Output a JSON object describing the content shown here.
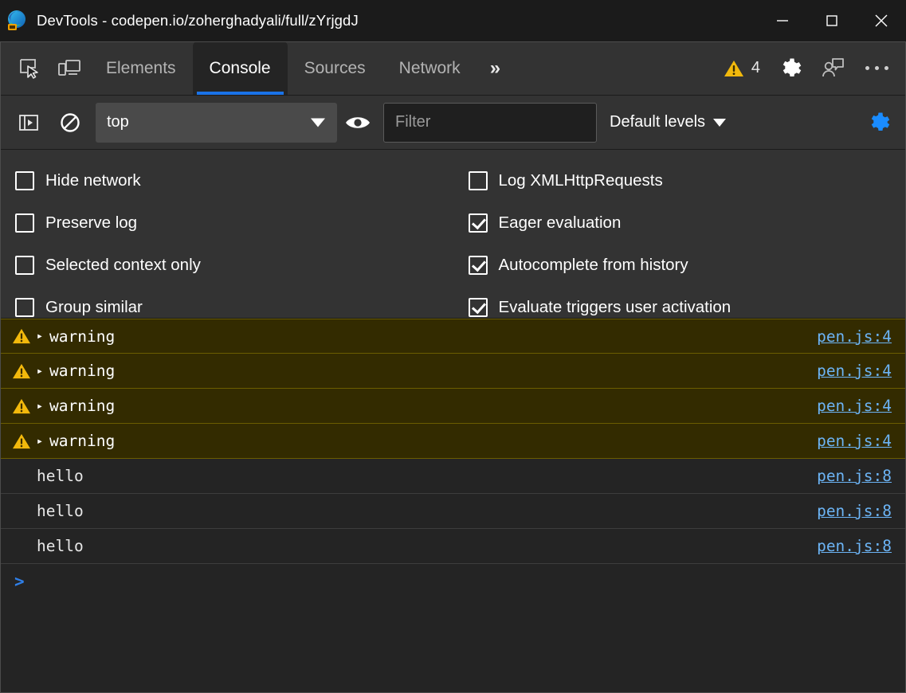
{
  "window": {
    "title": "DevTools - codepen.io/zoherghadyali/full/zYrjgdJ",
    "logo_icon": "edge-devtools-icon",
    "controls": {
      "minimize": "minimize-icon",
      "maximize": "maximize-icon",
      "close": "close-icon"
    }
  },
  "tabbar": {
    "inspect_icon": "inspect-element-icon",
    "device_icon": "device-toolbar-icon",
    "tabs": [
      {
        "label": "Elements",
        "active": false
      },
      {
        "label": "Console",
        "active": true
      },
      {
        "label": "Sources",
        "active": false
      },
      {
        "label": "Network",
        "active": false
      }
    ],
    "more_tabs": "»",
    "warning_icon": "warning-triangle-icon",
    "warning_count": "4",
    "settings_icon": "gear-icon",
    "feedback_icon": "feedback-person-icon",
    "more_icon": "more-options-icon"
  },
  "console_toolbar": {
    "sidebar_icon": "console-sidebar-icon",
    "clear_icon": "clear-console-icon",
    "context": {
      "value": "top",
      "caret": "chevron-down-icon"
    },
    "eye_icon": "live-expression-eye-icon",
    "filter": {
      "value": "",
      "placeholder": "Filter"
    },
    "levels": {
      "label": "Default levels",
      "caret": "chevron-down-icon"
    },
    "settings_gear": {
      "icon": "console-settings-gear-icon",
      "active_color": "#1a8cff"
    }
  },
  "settings_panel": {
    "left_column": [
      {
        "label": "Hide network",
        "checked": false
      },
      {
        "label": "Preserve log",
        "checked": false
      },
      {
        "label": "Selected context only",
        "checked": false
      },
      {
        "label": "Group similar",
        "checked": false
      }
    ],
    "right_column": [
      {
        "label": "Log XMLHttpRequests",
        "checked": false
      },
      {
        "label": "Eager evaluation",
        "checked": true
      },
      {
        "label": "Autocomplete from history",
        "checked": true
      },
      {
        "label": "Evaluate triggers user activation",
        "checked": true
      }
    ]
  },
  "console_messages": [
    {
      "level": "warning",
      "icon": "warning-triangle-icon",
      "expand": "▸",
      "text": "warning",
      "source": "pen.js:4"
    },
    {
      "level": "warning",
      "icon": "warning-triangle-icon",
      "expand": "▸",
      "text": "warning",
      "source": "pen.js:4"
    },
    {
      "level": "warning",
      "icon": "warning-triangle-icon",
      "expand": "▸",
      "text": "warning",
      "source": "pen.js:4"
    },
    {
      "level": "warning",
      "icon": "warning-triangle-icon",
      "expand": "▸",
      "text": "warning",
      "source": "pen.js:4"
    },
    {
      "level": "log",
      "icon": "",
      "expand": "",
      "text": "hello",
      "source": "pen.js:8"
    },
    {
      "level": "log",
      "icon": "",
      "expand": "",
      "text": "hello",
      "source": "pen.js:8"
    },
    {
      "level": "log",
      "icon": "",
      "expand": "",
      "text": "hello",
      "source": "pen.js:8"
    }
  ],
  "prompt": {
    "caret": ">",
    "value": ""
  },
  "colors": {
    "accent_blue": "#1a73e8",
    "link_blue": "#6cb4f5",
    "warning_yellow": "#f2b90c",
    "warning_row_bg": "#332b00",
    "warning_row_border": "#6b5d00",
    "toolbar_bg": "#333333",
    "panel_bg": "#242424",
    "titlebar_bg": "#1b1b1b"
  }
}
